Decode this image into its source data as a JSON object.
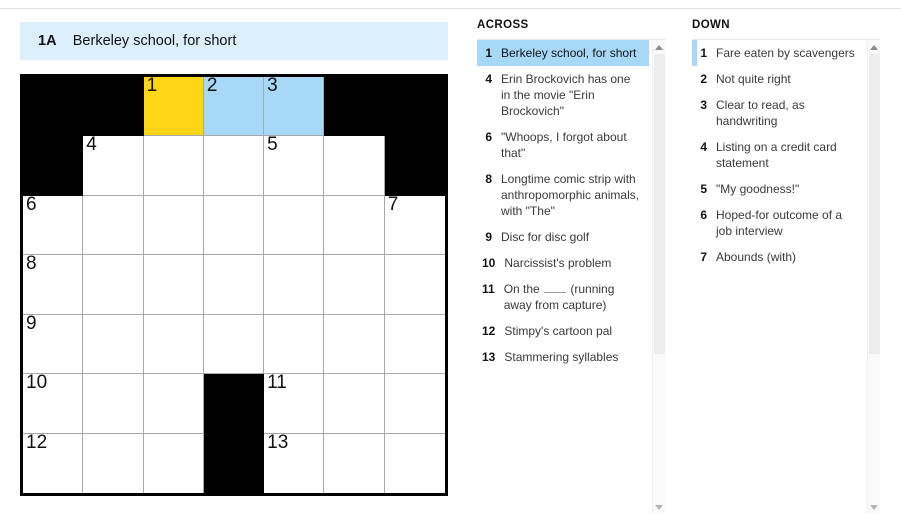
{
  "current_clue": {
    "number": "1A",
    "text": "Berkeley school, for short"
  },
  "colors": {
    "selected_cell": "#FFD617",
    "highlight_word": "#A7D8F8",
    "clue_bar_bg": "#DCEFFC",
    "block": "#000000",
    "grid_line": "#A8A8A8"
  },
  "grid": {
    "rows": 7,
    "cols": 7,
    "cells": [
      [
        {
          "type": "block"
        },
        {
          "type": "block"
        },
        {
          "type": "cell",
          "number": "1",
          "state": "selected",
          "letter": ""
        },
        {
          "type": "cell",
          "number": "2",
          "state": "highlight",
          "letter": ""
        },
        {
          "type": "cell",
          "number": "3",
          "state": "highlight",
          "letter": ""
        },
        {
          "type": "block"
        },
        {
          "type": "block"
        }
      ],
      [
        {
          "type": "block"
        },
        {
          "type": "cell",
          "number": "4",
          "state": "normal",
          "letter": ""
        },
        {
          "type": "cell",
          "number": "",
          "state": "normal",
          "letter": ""
        },
        {
          "type": "cell",
          "number": "",
          "state": "normal",
          "letter": ""
        },
        {
          "type": "cell",
          "number": "5",
          "state": "normal",
          "letter": ""
        },
        {
          "type": "cell",
          "number": "",
          "state": "normal",
          "letter": ""
        },
        {
          "type": "block"
        }
      ],
      [
        {
          "type": "cell",
          "number": "6",
          "state": "normal",
          "letter": ""
        },
        {
          "type": "cell",
          "number": "",
          "state": "normal",
          "letter": ""
        },
        {
          "type": "cell",
          "number": "",
          "state": "normal",
          "letter": ""
        },
        {
          "type": "cell",
          "number": "",
          "state": "normal",
          "letter": ""
        },
        {
          "type": "cell",
          "number": "",
          "state": "normal",
          "letter": ""
        },
        {
          "type": "cell",
          "number": "",
          "state": "normal",
          "letter": ""
        },
        {
          "type": "cell",
          "number": "7",
          "state": "normal",
          "letter": ""
        }
      ],
      [
        {
          "type": "cell",
          "number": "8",
          "state": "normal",
          "letter": ""
        },
        {
          "type": "cell",
          "number": "",
          "state": "normal",
          "letter": ""
        },
        {
          "type": "cell",
          "number": "",
          "state": "normal",
          "letter": ""
        },
        {
          "type": "cell",
          "number": "",
          "state": "normal",
          "letter": ""
        },
        {
          "type": "cell",
          "number": "",
          "state": "normal",
          "letter": ""
        },
        {
          "type": "cell",
          "number": "",
          "state": "normal",
          "letter": ""
        },
        {
          "type": "cell",
          "number": "",
          "state": "normal",
          "letter": ""
        }
      ],
      [
        {
          "type": "cell",
          "number": "9",
          "state": "normal",
          "letter": ""
        },
        {
          "type": "cell",
          "number": "",
          "state": "normal",
          "letter": ""
        },
        {
          "type": "cell",
          "number": "",
          "state": "normal",
          "letter": ""
        },
        {
          "type": "cell",
          "number": "",
          "state": "normal",
          "letter": ""
        },
        {
          "type": "cell",
          "number": "",
          "state": "normal",
          "letter": ""
        },
        {
          "type": "cell",
          "number": "",
          "state": "normal",
          "letter": ""
        },
        {
          "type": "cell",
          "number": "",
          "state": "normal",
          "letter": ""
        }
      ],
      [
        {
          "type": "cell",
          "number": "10",
          "state": "normal",
          "letter": ""
        },
        {
          "type": "cell",
          "number": "",
          "state": "normal",
          "letter": ""
        },
        {
          "type": "cell",
          "number": "",
          "state": "normal",
          "letter": ""
        },
        {
          "type": "block"
        },
        {
          "type": "cell",
          "number": "11",
          "state": "normal",
          "letter": ""
        },
        {
          "type": "cell",
          "number": "",
          "state": "normal",
          "letter": ""
        },
        {
          "type": "cell",
          "number": "",
          "state": "normal",
          "letter": ""
        }
      ],
      [
        {
          "type": "cell",
          "number": "12",
          "state": "normal",
          "letter": ""
        },
        {
          "type": "cell",
          "number": "",
          "state": "normal",
          "letter": ""
        },
        {
          "type": "cell",
          "number": "",
          "state": "normal",
          "letter": ""
        },
        {
          "type": "block"
        },
        {
          "type": "cell",
          "number": "13",
          "state": "normal",
          "letter": ""
        },
        {
          "type": "cell",
          "number": "",
          "state": "normal",
          "letter": ""
        },
        {
          "type": "cell",
          "number": "",
          "state": "normal",
          "letter": ""
        }
      ]
    ]
  },
  "across": {
    "title": "ACROSS",
    "clues": [
      {
        "number": "1",
        "text": "Berkeley school, for short",
        "state": "selected"
      },
      {
        "number": "4",
        "text": "Erin Brockovich has one in the movie \"Erin Brockovich\"",
        "state": "plain"
      },
      {
        "number": "6",
        "text": "\"Whoops, I forgot about that\"",
        "state": "plain"
      },
      {
        "number": "8",
        "text": "Longtime comic strip with anthropomorphic animals, with \"The\"",
        "state": "plain"
      },
      {
        "number": "9",
        "text": "Disc for disc golf",
        "state": "plain"
      },
      {
        "number": "10",
        "text": "Narcissist's problem",
        "state": "plain"
      },
      {
        "number": "11",
        "text": "On the ___ (running away from capture)",
        "state": "plain",
        "has_blank": true,
        "before_blank": "On the ",
        "after_blank": " (running away from capture)"
      },
      {
        "number": "12",
        "text": "Stimpy's cartoon pal",
        "state": "plain"
      },
      {
        "number": "13",
        "text": "Stammering syllables",
        "state": "plain"
      }
    ],
    "scrollbar": {
      "up_arrow": "scroll-up-arrow",
      "down_arrow": "scroll-down-arrow"
    }
  },
  "down": {
    "title": "DOWN",
    "clues": [
      {
        "number": "1",
        "text": "Fare eaten by scavengers",
        "state": "crossed"
      },
      {
        "number": "2",
        "text": "Not quite right",
        "state": "plain"
      },
      {
        "number": "3",
        "text": "Clear to read, as handwriting",
        "state": "plain"
      },
      {
        "number": "4",
        "text": "Listing on a credit card statement",
        "state": "plain"
      },
      {
        "number": "5",
        "text": "\"My goodness!\"",
        "state": "plain"
      },
      {
        "number": "6",
        "text": "Hoped-for outcome of a job interview",
        "state": "plain"
      },
      {
        "number": "7",
        "text": "Abounds (with)",
        "state": "plain"
      }
    ],
    "scrollbar": {
      "up_arrow": "scroll-up-arrow",
      "down_arrow": "scroll-down-arrow"
    }
  }
}
